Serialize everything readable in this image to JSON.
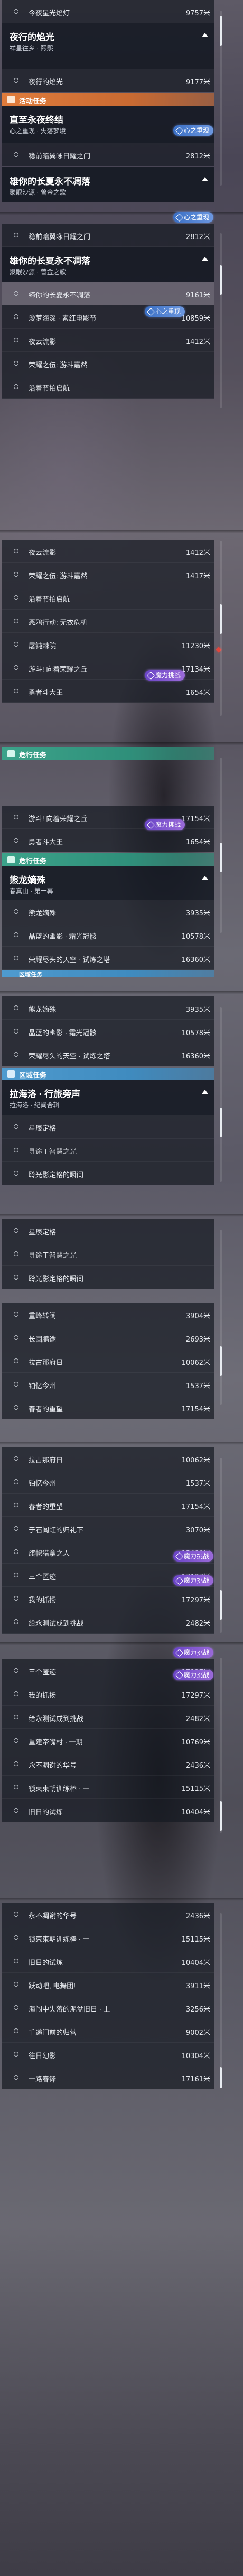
{
  "labels": {
    "activity": "活动任务",
    "special": "危行任务",
    "area": "区域任务",
    "tag_lower_bound": "心之重现",
    "tag_daily": "魔力挑战",
    "tag_area": "区域任务"
  },
  "quests": {
    "q1": {
      "name": "今夜星光焰灯",
      "dist": "9757米"
    },
    "night_title": "夜行的焰光",
    "night_sub": "祥星往乡 · 熙熙",
    "q2": {
      "name": "夜行的焰光",
      "dist": "9177米"
    },
    "wt_title": "直至永夜终结",
    "wt_sub": "心之重现 · 失落梦境",
    "q3": {
      "name": "稳前暗翼咏日耀之门",
      "dist": "2812米"
    },
    "wt2_title": "雄你的长夏永不凋落",
    "wt2_sub": "聚眼沙源 · 曾金之歌",
    "q4": {
      "name": "稳前暗翼咏日耀之门",
      "dist": "2812米"
    },
    "long_title": "雄你的长夏永不凋落",
    "long_sub": "聚眼沙源 · 曾金之歌",
    "q5": {
      "name": "缔你的长夏永不凋落",
      "dist": "9161米"
    },
    "q6": {
      "name": "浚梦海深 · 素红电影节",
      "dist": "10859米"
    },
    "q7": {
      "name": "夜云流影",
      "dist": "1412米"
    },
    "q8": {
      "name": "荣耀之伍: 游斗嘉然",
      "dist": ""
    },
    "q9": {
      "name": "沿着节拍启航",
      "dist": ""
    },
    "q10": {
      "name": "夜云流影",
      "dist": "1412米"
    },
    "q11": {
      "name": "荣耀之伍: 游斗嘉然",
      "dist": "1417米"
    },
    "q12": {
      "name": "沿着节拍启航",
      "dist": ""
    },
    "q13": {
      "name": "恶鸦行动: 无衣危机",
      "dist": ""
    },
    "q14": {
      "name": "屠钝棘院",
      "dist": "11230米"
    },
    "q15": {
      "name": "游斗! 向着荣耀之丘",
      "dist": "17134米"
    },
    "q16": {
      "name": "勇者斗大王",
      "dist": "1654米"
    },
    "q17": {
      "name": "游斗! 向着荣耀之丘",
      "dist": "17154米"
    },
    "q18": {
      "name": "勇者斗大王",
      "dist": "1654米"
    },
    "yl_title": "熊龙嫡殊",
    "yl_sub": "春真山 · 第一幕",
    "q19": {
      "name": "熊龙嫡殊",
      "dist": "3935米"
    },
    "q20": {
      "name": "晶蓝的幽影 · 霜光冠骸",
      "dist": "10578米"
    },
    "q21": {
      "name": "荣耀尽头的天空 · 试炼之塔",
      "dist": "16360米"
    },
    "q22": {
      "name": "熊龙嫡殊",
      "dist": "3935米"
    },
    "q23": {
      "name": "晶蓝的幽影 · 霜光冠骸",
      "dist": "10578米"
    },
    "q24": {
      "name": "荣耀尽头的天空 · 试炼之塔",
      "dist": "16360米"
    },
    "la_title": "拉海洛 · 行旅旁声",
    "la_sub": "拉海洛 · 纪闻合辑",
    "q25": {
      "name": "星辰定格",
      "dist": ""
    },
    "q26": {
      "name": "寻途于智慧之光",
      "dist": ""
    },
    "q27": {
      "name": "聆光影定格的瞬间",
      "dist": ""
    },
    "q28": {
      "name": "星辰定格",
      "dist": ""
    },
    "q29": {
      "name": "寻途于智慧之光",
      "dist": ""
    },
    "q30": {
      "name": "聆光影定格的瞬间",
      "dist": ""
    },
    "q31": {
      "name": "重峰转阔",
      "dist": "3904米"
    },
    "q32": {
      "name": "长固鹏途",
      "dist": "2693米"
    },
    "q33": {
      "name": "拉古那府日",
      "dist": "10062米"
    },
    "q34": {
      "name": "铂忆今州",
      "dist": "1537米"
    },
    "q35": {
      "name": "春者的重望",
      "dist": "17154米"
    },
    "q36": {
      "name": "拉古那府日",
      "dist": "10062米"
    },
    "q37": {
      "name": "铂忆今州",
      "dist": "1537米"
    },
    "q38": {
      "name": "春者的重望",
      "dist": "17154米"
    },
    "q39": {
      "name": "于石闾虹的归礼下",
      "dist": "3070米"
    },
    "q40": {
      "name": "旗帜猎拿之人",
      "dist": "15480米"
    },
    "q41": {
      "name": "三个匿迹",
      "dist": "17127米"
    },
    "q42": {
      "name": "我的抓扬",
      "dist": "17297米"
    },
    "q43": {
      "name": "给永测试成到挑战",
      "dist": "2482米"
    },
    "q44": {
      "name": "三个匿迹",
      "dist": "17127米"
    },
    "q45": {
      "name": "我的抓扬",
      "dist": "17297米"
    },
    "q46": {
      "name": "给永测试成到挑战",
      "dist": "2482米"
    },
    "q47": {
      "name": "重建帝嘴村 · 一期",
      "dist": "10769米"
    },
    "q48": {
      "name": "永不凋谢的华号",
      "dist": "2436米"
    },
    "q49": {
      "name": "锁束束朝训练棒 · 一",
      "dist": "15115米"
    },
    "q50": {
      "name": "旧日的试炼",
      "dist": "10404米"
    },
    "q51": {
      "name": "永不凋谢的华号",
      "dist": "2436米"
    },
    "q52": {
      "name": "锁束束朝训练棒 · 一",
      "dist": "15115米"
    },
    "q53": {
      "name": "旧日的试炼",
      "dist": "10404米"
    },
    "q54": {
      "name": "跃动吧, 电舞团!",
      "dist": "3911米"
    },
    "q55": {
      "name": "海闯中失落的泥盆旧日 · 上",
      "dist": "3256米"
    },
    "q56": {
      "name": "千递门前的归营",
      "dist": "9002米"
    },
    "q57": {
      "name": "往日幻影",
      "dist": "10304米"
    },
    "q58": {
      "name": "一路春锋",
      "dist": "17161米"
    }
  }
}
